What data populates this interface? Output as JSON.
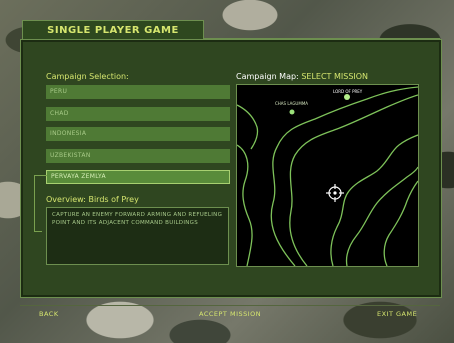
{
  "title": "SINGLE PLAYER GAME",
  "campaign": {
    "heading": "Campaign Selection:",
    "items": [
      "PERU",
      "CHAD",
      "INDONESIA",
      "UZBEKISTAN",
      "PERVAYA ZEMLYA"
    ],
    "selected_index": 4
  },
  "overview": {
    "label": "Overview:",
    "mission_name": "Birds of Prey",
    "description": "CAPTURE AN ENEMY FORWARD ARMING AND REFUELING POINT AND ITS ADJACENT COMMAND BUILDINGS"
  },
  "map": {
    "heading": "Campaign Map:",
    "status": "SELECT MISSION",
    "markers": [
      "CHAS LAGUMMA",
      "LORD OF PREY"
    ]
  },
  "buttons": {
    "back": "BACK",
    "accept": "ACCEPT MISSION",
    "exit": "EXIT GAME"
  },
  "colors": {
    "accent": "#d6e66f",
    "panel": "#2f4620",
    "map_contour": "#7ec25a"
  }
}
